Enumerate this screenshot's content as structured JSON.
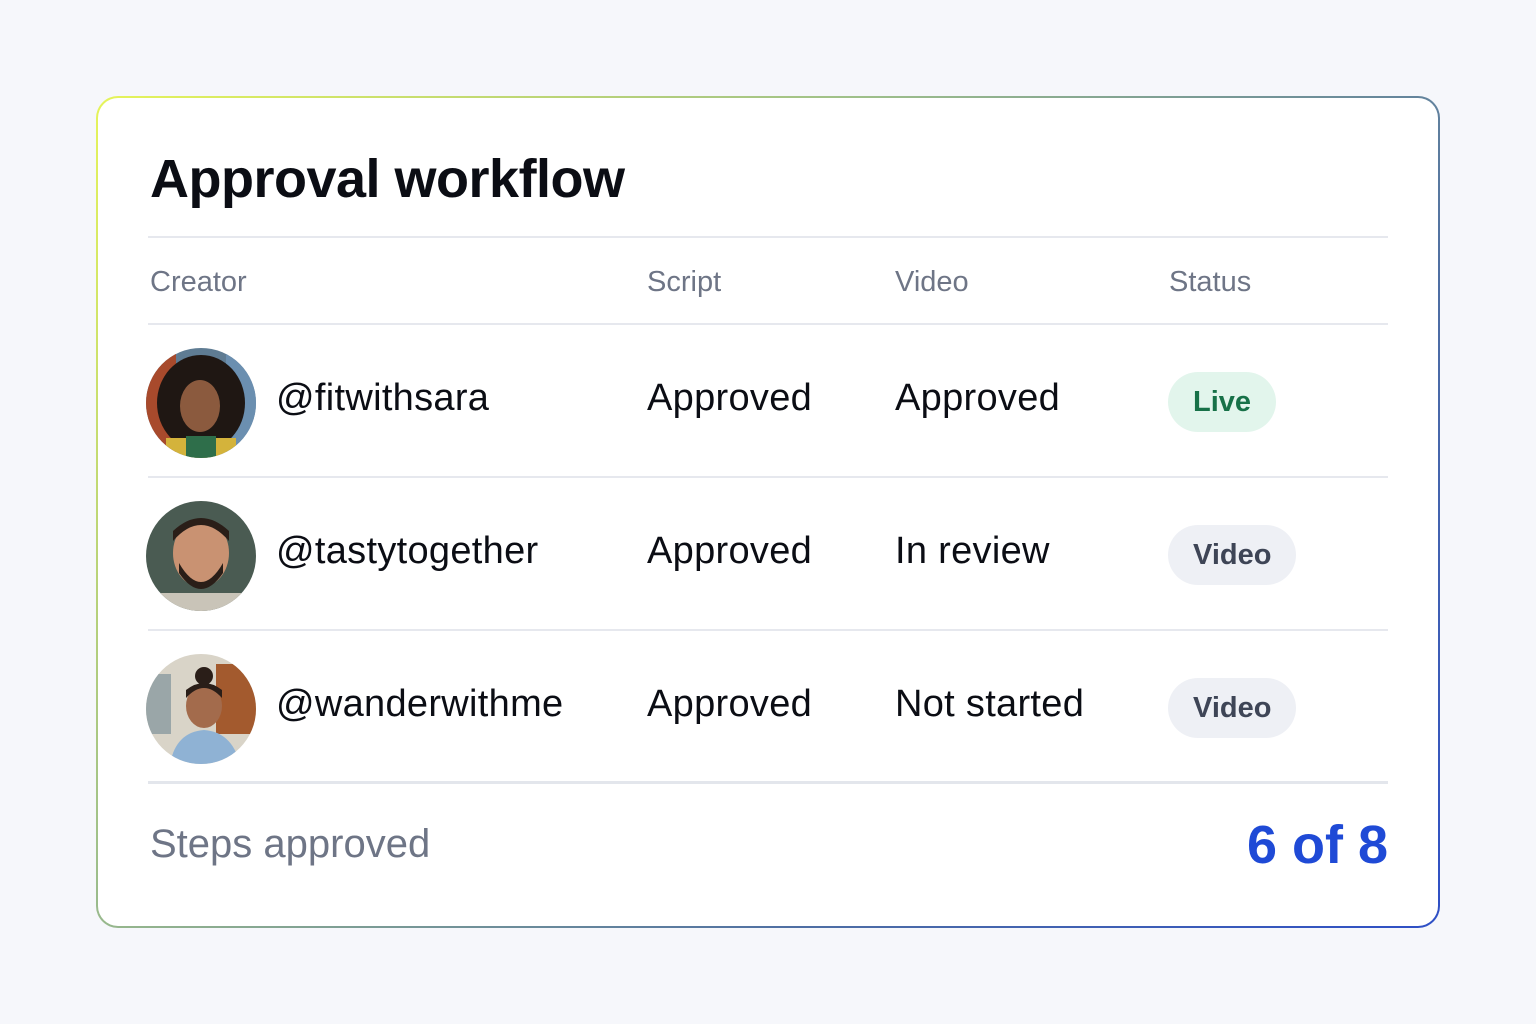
{
  "card": {
    "title": "Approval workflow"
  },
  "table": {
    "headers": {
      "creator": "Creator",
      "script": "Script",
      "video": "Video",
      "status": "Status"
    },
    "rows": [
      {
        "creator": "@fitwithsara",
        "script": "Approved",
        "video": "Approved",
        "status": "Live",
        "status_kind": "live"
      },
      {
        "creator": "@tastytogether",
        "script": "Approved",
        "video": "In review",
        "status": "Video",
        "status_kind": "neutral"
      },
      {
        "creator": "@wanderwithme",
        "script": "Approved",
        "video": "Not started",
        "status": "Video",
        "status_kind": "neutral"
      }
    ]
  },
  "footer": {
    "label": "Steps approved",
    "value": "6 of 8"
  },
  "colors": {
    "accent": "#1f4ad6",
    "live_bg": "#e2f5ec",
    "live_text": "#177148",
    "neutral_bg": "#eef0f5",
    "neutral_text": "#3e4556"
  }
}
